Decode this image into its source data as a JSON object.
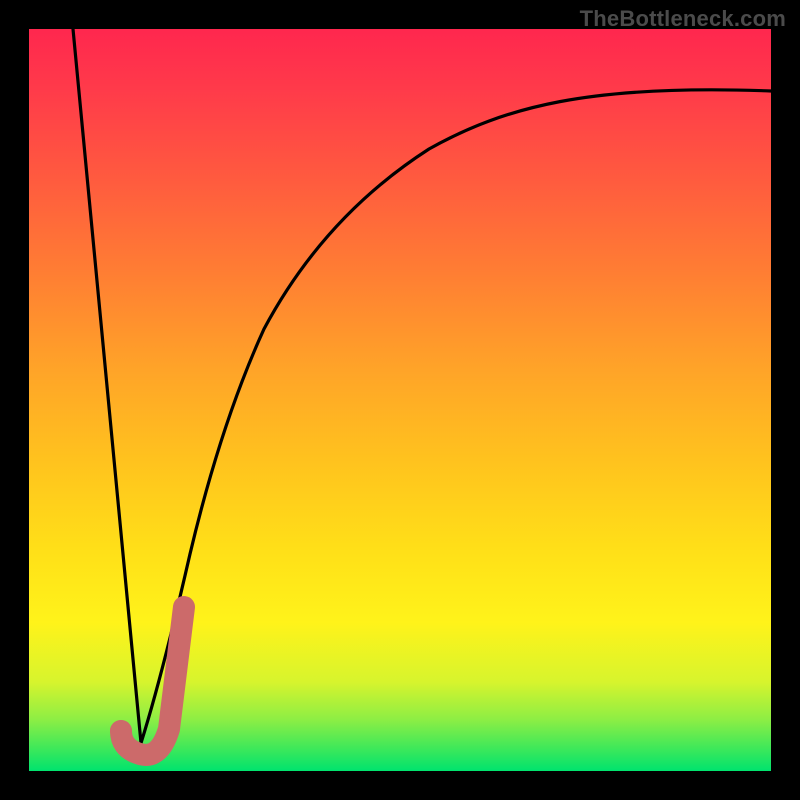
{
  "watermark": "TheBottleneck.com",
  "colors": {
    "frame": "#000000",
    "curve": "#000000",
    "marker_stroke": "#cc6a6a",
    "marker_fill": "#cc6a6a",
    "gradient_top": "#ff274e",
    "gradient_bottom": "#00e36e"
  },
  "chart_data": {
    "type": "line",
    "title": "",
    "xlabel": "",
    "ylabel": "",
    "xlim": [
      0,
      100
    ],
    "ylim": [
      0,
      100
    ],
    "series": [
      {
        "name": "left-descending-line",
        "x": [
          6.0,
          15.0
        ],
        "values": [
          100.0,
          4.0
        ]
      },
      {
        "name": "right-rising-curve",
        "x": [
          15.0,
          17.0,
          19.0,
          21.2,
          23.5,
          26.0,
          29.0,
          32.5,
          36.5,
          41.0,
          46.0,
          52.0,
          59.0,
          67.0,
          76.0,
          86.0,
          100.0
        ],
        "values": [
          4.0,
          11.0,
          20.0,
          29.0,
          38.0,
          46.0,
          54.0,
          61.0,
          67.5,
          73.0,
          77.5,
          81.2,
          84.2,
          86.6,
          88.5,
          90.0,
          91.7
        ]
      }
    ],
    "marker": {
      "name": "J-marker",
      "x_range": [
        12.5,
        21.0
      ],
      "y_range": [
        2.0,
        22.0
      ]
    }
  }
}
